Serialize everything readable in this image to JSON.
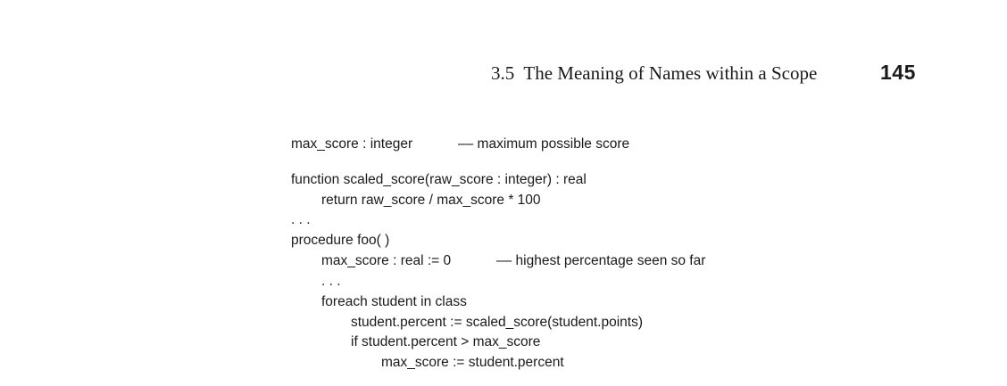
{
  "header": {
    "section_title": "3.5  The Meaning of Names within a Scope",
    "page_number": "145"
  },
  "code": {
    "line_1": "max_score : integer",
    "line_1_comment": "–– maximum possible score",
    "line_2": "function scaled_score(raw_score : integer) : real",
    "line_3": "return raw_score / max_score * 100",
    "line_4": ". . .",
    "line_5": "procedure foo( )",
    "line_6": "max_score : real := 0",
    "line_6_comment": "–– highest percentage seen so far",
    "line_7": ". . .",
    "line_8": "foreach student in class",
    "line_9": "student.percent := scaled_score(student.points)",
    "line_10": "if student.percent > max_score",
    "line_11": "max_score := student.percent"
  }
}
